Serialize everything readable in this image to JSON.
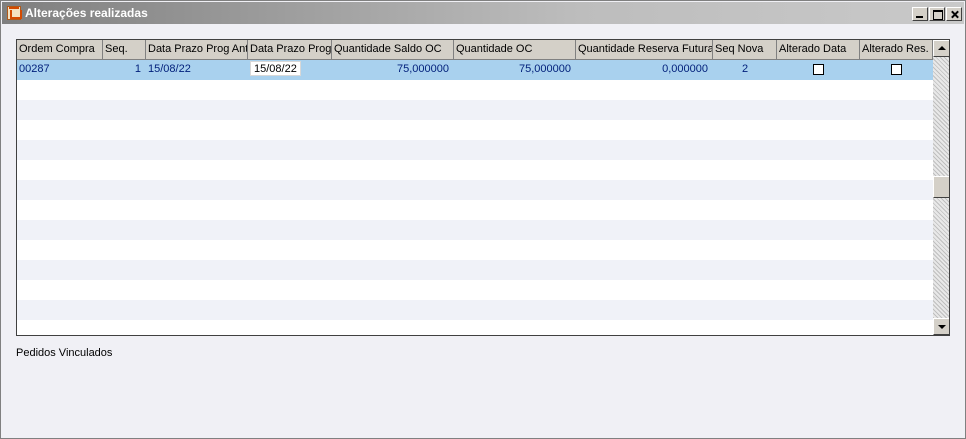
{
  "window": {
    "title": "Alterações realizadas",
    "icon": "app-house-icon",
    "controls": [
      "minimize",
      "maximize",
      "close"
    ]
  },
  "grid": {
    "columns": [
      "Ordem Compra",
      "Seq.",
      "Data Prazo Prog Ant",
      "Data Prazo Prog",
      "Quantidade Saldo OC",
      "Quantidade OC",
      "Quantidade Reserva Futura",
      "Seq Nova",
      "Alterado Data",
      "Alterado Res."
    ],
    "rows": [
      {
        "ordem_compra": "00287",
        "seq": "1",
        "data_prazo_prog_ant": "15/08/22",
        "data_prazo_prog": "15/08/22",
        "quantidade_saldo_oc": "75,000000",
        "quantidade_oc": "75,000000",
        "quantidade_reserva_futura": "0,000000",
        "seq_nova": "2",
        "alterado_data": false,
        "alterado_res": false
      }
    ],
    "colors": {
      "selected_row": "#a9d1ee",
      "alt_row": "#f0f2f8",
      "cell_text": "#001f7a"
    }
  },
  "footer": {
    "label": "Pedidos Vinculados"
  }
}
